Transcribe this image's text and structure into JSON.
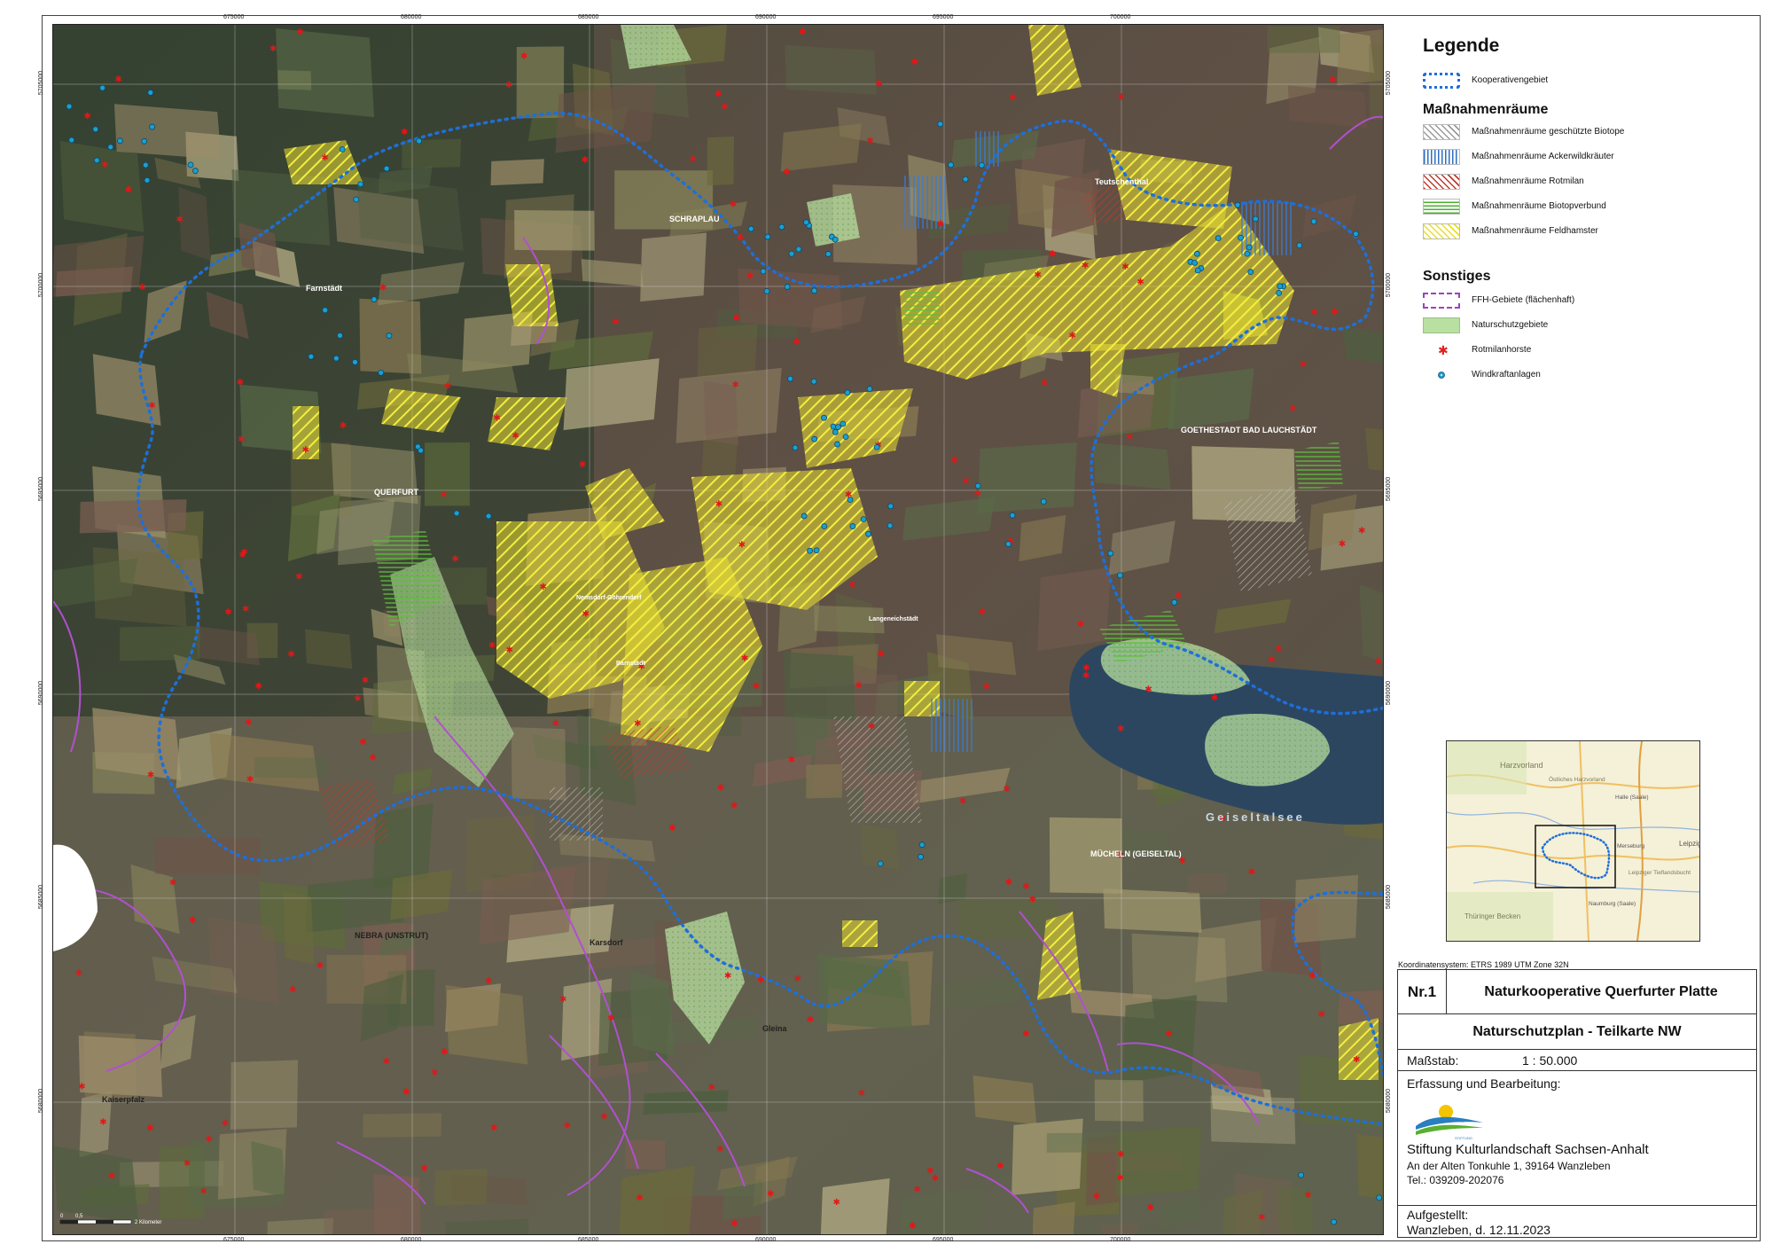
{
  "map": {
    "grid_top": [
      "675000",
      "680000",
      "685000",
      "690000",
      "695000",
      "700000"
    ],
    "grid_left": [
      "5705000",
      "5700000",
      "5695000",
      "5690000",
      "5685000",
      "5680000"
    ],
    "place_names": [
      "SCHRAPLAU",
      "Teutschenthal",
      "Farnstädt",
      "QUERFURT",
      "GOETHESTADT BAD LAUCHSTÄDT",
      "MÜCHELN (GEISELTAL)",
      "NEBRA (UNSTRUT)",
      "Karsdorf",
      "Gleina",
      "Kaiserpfalz",
      "Geiseltalsee",
      "Langeneichstädt",
      "Barnstädt",
      "Nemsdorf-Göhrendorf"
    ],
    "scalebar": {
      "label_0": "0",
      "label_05": "0,5",
      "label_2": "2 Kilometer"
    }
  },
  "legend": {
    "title": "Legende",
    "cooperation": {
      "label": "Kooperativengebiet",
      "color": "#1e6fd9"
    },
    "section_measures": "Maßnahmenräume",
    "measures": [
      {
        "label": "Maßnahmenräume geschützte Biotope",
        "color": "#9a9a9a",
        "pattern": "diagonal-hatch"
      },
      {
        "label": "Maßnahmenräume Ackerwildkräuter",
        "color": "#2f6fbf",
        "pattern": "vertical-lines"
      },
      {
        "label": "Maßnahmenräume Rotmilan",
        "color": "#c0392b",
        "pattern": "diagonal-hatch"
      },
      {
        "label": "Maßnahmenräume Biotopverbund",
        "color": "#4caf30",
        "pattern": "horizontal-lines"
      },
      {
        "label": "Maßnahmenräume Feldhamster",
        "color": "#e8e020",
        "pattern": "diagonal-hatch"
      }
    ],
    "section_other": "Sonstiges",
    "other": [
      {
        "label": "FFH-Gebiete (flächenhaft)",
        "color": "#a040c0",
        "pattern": "dashed-outline"
      },
      {
        "label": "Naturschutzgebiete",
        "color": "#b8e0a0",
        "pattern": "dotted-fill"
      },
      {
        "label": "Rotmilanhorste",
        "color": "#e02020",
        "pattern": "star-point"
      },
      {
        "label": "Windkraftanlagen",
        "color": "#1aa0d0",
        "pattern": "circle-point"
      }
    ]
  },
  "crs": "Koordinatensystem: ETRS 1989 UTM Zone 32N",
  "titleblock": {
    "nr": "Nr.1",
    "project": "Naturkooperative Querfurter Platte",
    "subtitle": "Naturschutzplan - Teilkarte NW",
    "scale_label": "Maßstab:",
    "scale_value": "1 : 50.000",
    "credits_label": "Erfassung und Bearbeitung:",
    "logo_text": "STIFTUNG Kulturlandschaft Sachsen-Anhalt",
    "org": "Stiftung Kulturlandschaft Sachsen-Anhalt",
    "address": "An der Alten Tonkuhle 1, 39164 Wanzleben",
    "phone": "Tel.: 039209-202076",
    "prepared_label": "Aufgestellt:",
    "prepared_value": "Wanzleben, d. 12.11.2023"
  },
  "overview": {
    "labels": [
      "Harzvorland",
      "Halle (Saale)",
      "Leipzig",
      "Thüringer Becken",
      "Östliches Harzvorland",
      "Merseburg",
      "Naumburg (Saale)",
      "Leipziger Tieflandsbucht"
    ]
  }
}
